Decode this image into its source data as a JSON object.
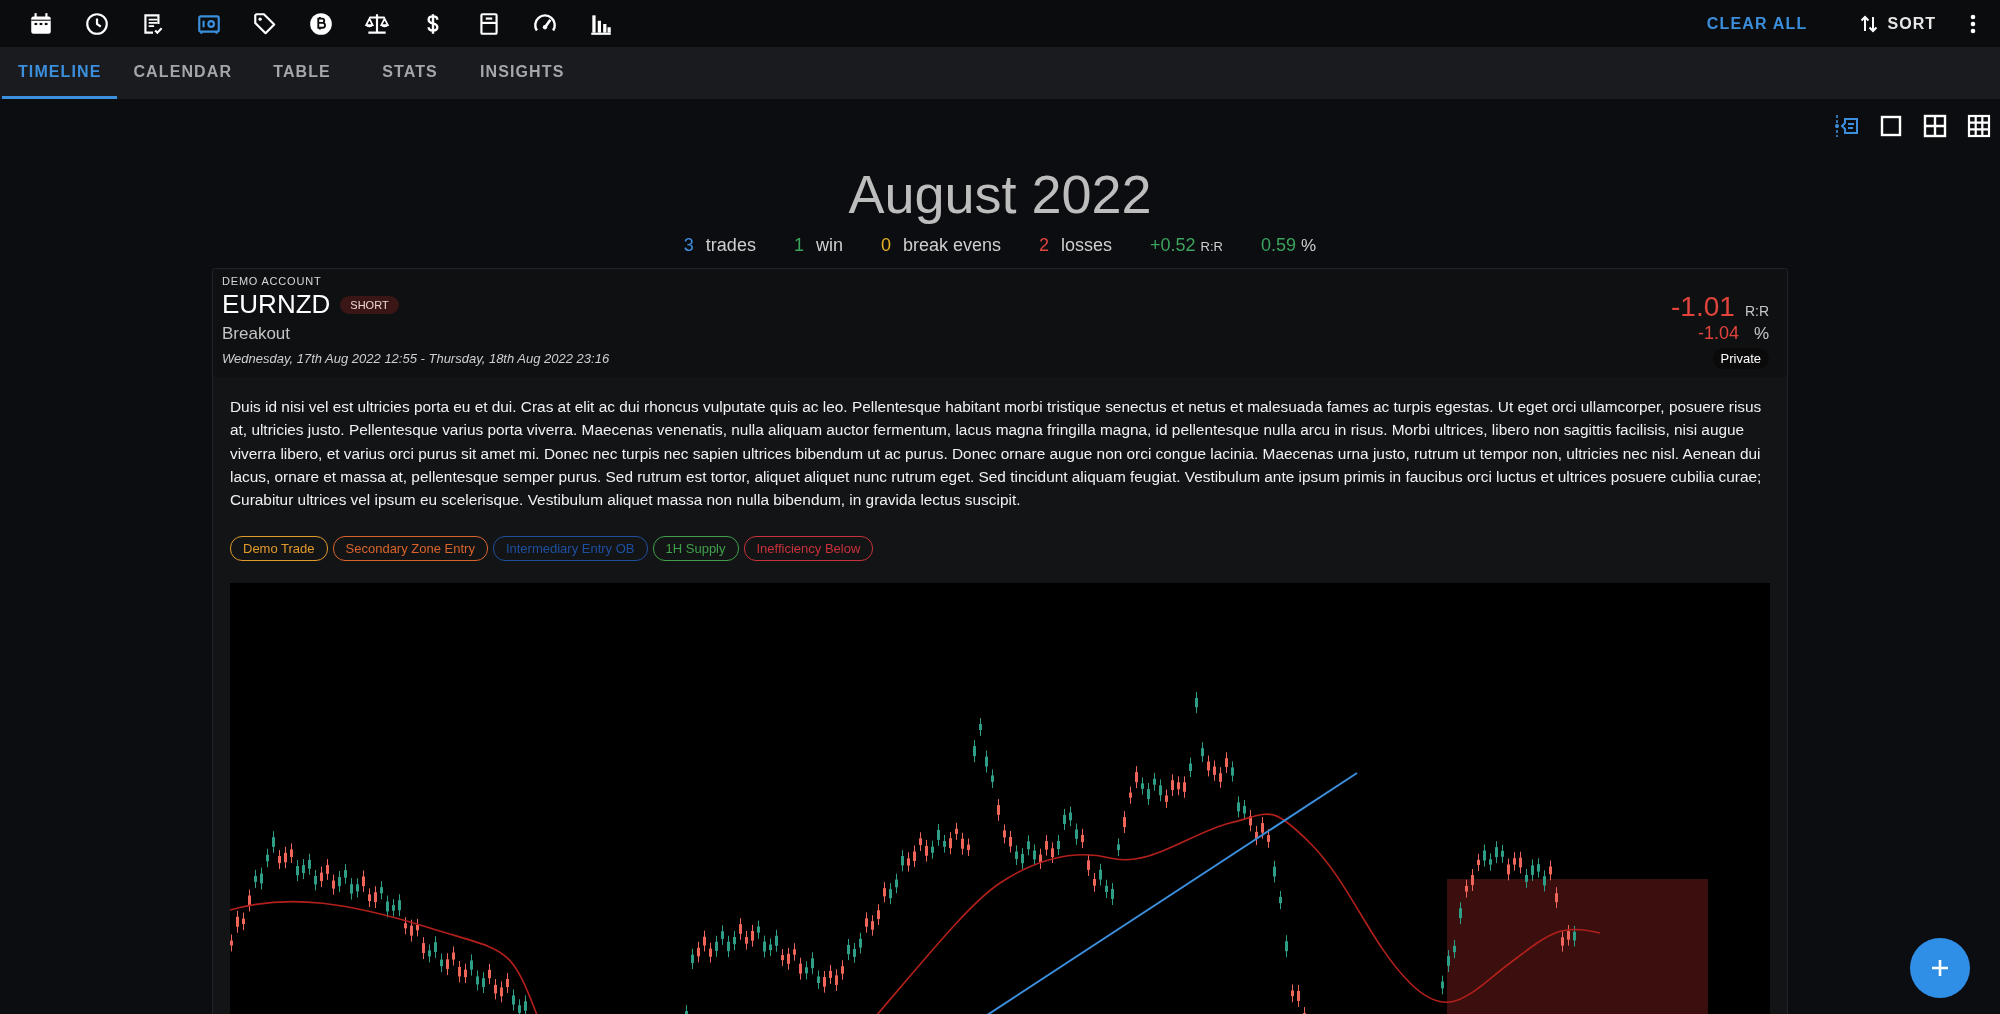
{
  "toolbar": [
    {
      "selected": false
    },
    {
      "selected": false
    },
    {
      "selected": false
    },
    {
      "selected": true
    },
    {
      "selected": false
    },
    {
      "selected": false
    },
    {
      "selected": false
    },
    {
      "selected": false
    },
    {
      "selected": false
    },
    {
      "selected": false
    },
    {
      "selected": false
    }
  ],
  "actions": {
    "clear": "CLEAR ALL",
    "sort": "SORT"
  },
  "tabs": [
    {
      "label": "TIMELINE",
      "selected": true
    },
    {
      "label": "CALENDAR",
      "selected": false
    },
    {
      "label": "TABLE",
      "selected": false
    },
    {
      "label": "STATS",
      "selected": false
    },
    {
      "label": "INSIGHTS",
      "selected": false
    }
  ],
  "view_modes": [
    {
      "selected": true
    },
    {
      "selected": false
    },
    {
      "selected": false
    },
    {
      "selected": false
    }
  ],
  "month": {
    "title": "August 2022",
    "stats": [
      {
        "value": "3",
        "label": "trades",
        "color": "#3d8fe0"
      },
      {
        "value": "1",
        "label": "win",
        "color": "#3aa35c"
      },
      {
        "value": "0",
        "label": "break evens",
        "color": "#e6b325"
      },
      {
        "value": "2",
        "label": "losses",
        "color": "#e0443c"
      },
      {
        "value": "+0.52",
        "label": "R:R",
        "color": "#3aa35c"
      },
      {
        "value": "0.59",
        "label": "%",
        "color": "#3aa35c"
      }
    ]
  },
  "trade": {
    "account": "DEMO ACCOUNT",
    "symbol": "EURNZD",
    "direction": "SHORT",
    "setup": "Breakout",
    "dates": "Wednesday, 17th Aug 2022 12:55 - Thursday, 18th Aug 2022 23:16",
    "rr": "-1.01",
    "rr_unit": "R:R",
    "pct": "-1.04",
    "pct_unit": "%",
    "visibility": "Private",
    "notes": "Duis id nisi vel est ultricies porta eu et dui. Cras at elit ac dui rhoncus vulputate quis ac leo. Pellentesque habitant morbi tristique senectus et netus et malesuada fames ac turpis egestas. Ut eget orci ullamcorper, posuere risus at, ultricies justo. Pellentesque varius porta viverra. Maecenas venenatis, nulla aliquam auctor fermentum, lacus magna fringilla magna, id pellentesque nulla arcu in risus. Morbi ultrices, libero non sagittis facilisis, nisi augue viverra libero, et varius orci purus sit amet mi. Donec nec turpis nec sapien ultrices bibendum ut ac purus. Donec ornare augue non orci congue lacinia. Maecenas urna justo, rutrum ut tempor non, ultricies nec nisl. Aenean dui lacus, ornare et massa at, pellentesque semper purus. Sed rutrum est tortor, aliquet aliquet nunc rutrum eget. Sed tincidunt aliquam feugiat. Vestibulum ante ipsum primis in faucibus orci luctus et ultrices posuere cubilia curae; Curabitur ultrices vel ipsum eu scelerisque. Vestibulum aliquet massa non nulla bibendum, in gravida lectus suscipit.",
    "tags": [
      {
        "label": "Demo Trade",
        "color": "#e09a2a"
      },
      {
        "label": "Secondary Zone Entry",
        "color": "#d9642a"
      },
      {
        "label": "Intermediary Entry OB",
        "color": "#1f4fa0"
      },
      {
        "label": "1H Supply",
        "color": "#3fa04a"
      },
      {
        "label": "Inefficiency Below",
        "color": "#c8323a"
      }
    ]
  }
}
